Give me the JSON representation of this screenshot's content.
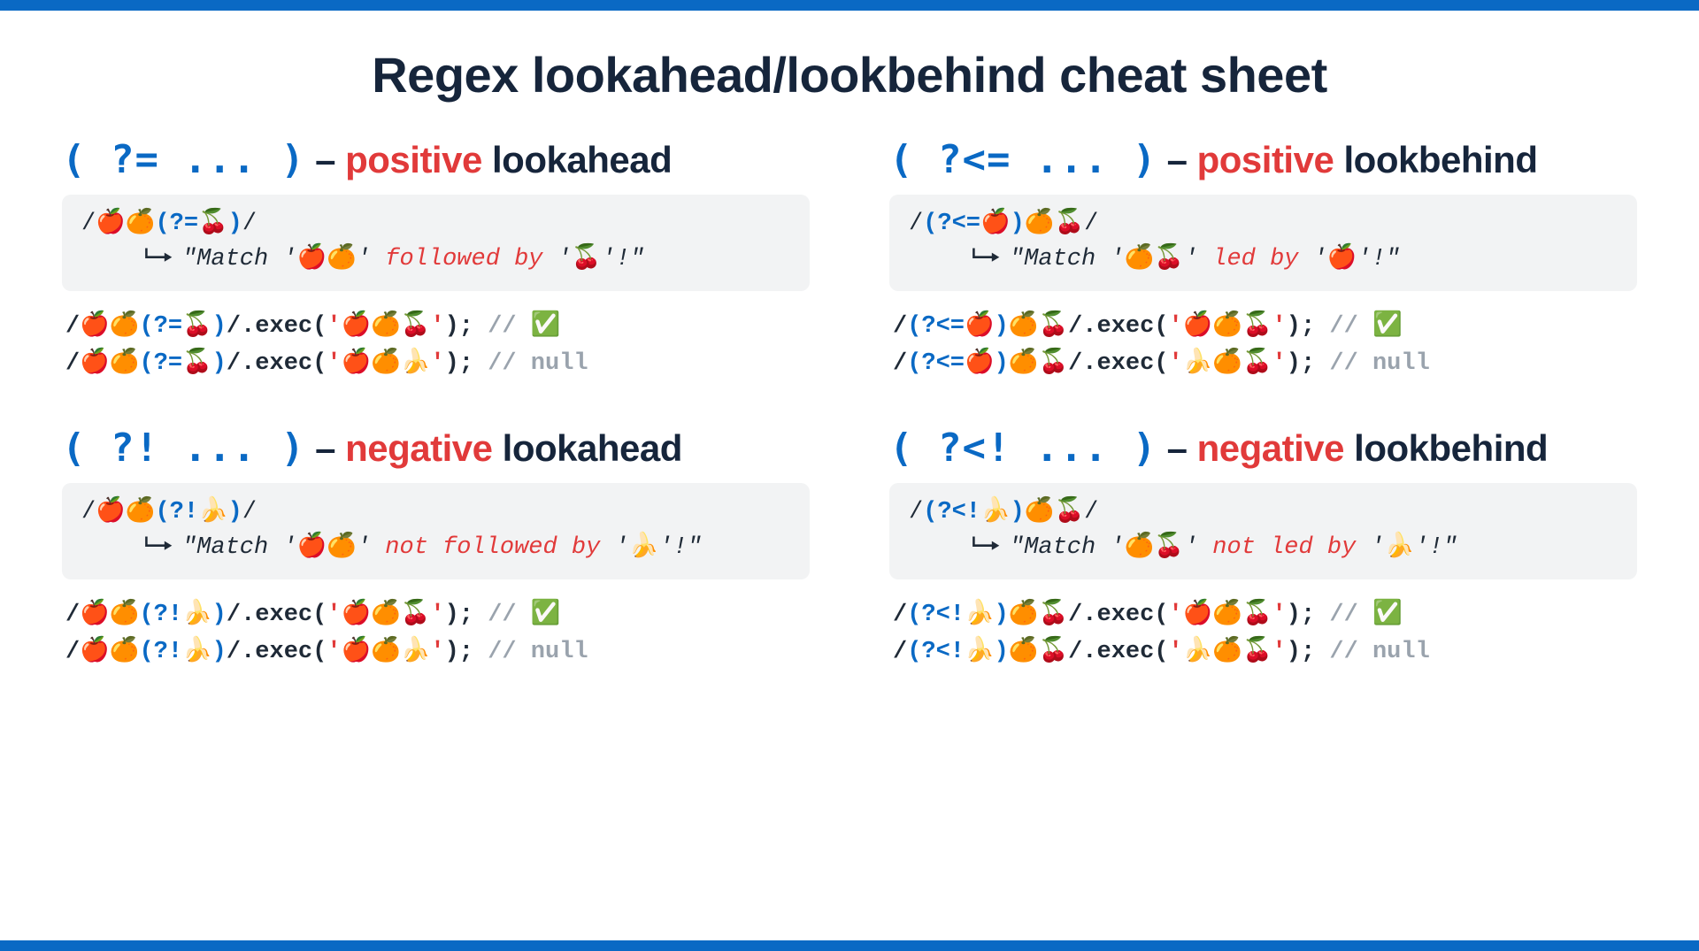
{
  "title": "Regex lookahead/lookbehind cheat sheet",
  "sections": [
    {
      "syntax": "( ?= ... )",
      "dash": " – ",
      "kind": "positive",
      "what": " lookahead",
      "box": {
        "pre": "/🍎🍊",
        "grp": "(?=🍒)",
        "post": "/",
        "desc_a": "\"Match '",
        "desc_b": "🍎🍊",
        "desc_c": "' ",
        "desc_em": "followed by",
        "desc_d": " '",
        "desc_e": "🍒",
        "desc_f": "'!\""
      },
      "ex": [
        {
          "pre": "/🍎🍊",
          "grp": "(?=🍒)",
          "mid": "/.exec(",
          "str": "'🍎🍊🍒'",
          "post": "); ",
          "cmt": "// ✅"
        },
        {
          "pre": "/🍎🍊",
          "grp": "(?=🍒)",
          "mid": "/.exec(",
          "str": "'🍎🍊🍌'",
          "post": "); ",
          "cmt": "// null"
        }
      ]
    },
    {
      "syntax": "( ?<= ... )",
      "dash": " – ",
      "kind": "positive",
      "what": " lookbehind",
      "box": {
        "pre": "/",
        "grp": "(?<=🍎)",
        "post": "🍊🍒/",
        "desc_a": "\"Match '",
        "desc_b": "🍊🍒",
        "desc_c": "' ",
        "desc_em": "led by",
        "desc_d": " '",
        "desc_e": "🍎",
        "desc_f": "'!\""
      },
      "ex": [
        {
          "pre": "/",
          "grp": "(?<=🍎)",
          "mid": "🍊🍒/.exec(",
          "str": "'🍎🍊🍒'",
          "post": "); ",
          "cmt": "// ✅"
        },
        {
          "pre": "/",
          "grp": "(?<=🍎)",
          "mid": "🍊🍒/.exec(",
          "str": "'🍌🍊🍒'",
          "post": "); ",
          "cmt": "// null"
        }
      ]
    },
    {
      "syntax": "( ?! ... )",
      "dash": " – ",
      "kind": "negative",
      "what": " lookahead",
      "box": {
        "pre": "/🍎🍊",
        "grp": "(?!🍌)",
        "post": "/",
        "desc_a": "\"Match '",
        "desc_b": "🍎🍊",
        "desc_c": "' ",
        "desc_em": "not followed by",
        "desc_d": " '",
        "desc_e": "🍌",
        "desc_f": "'!\""
      },
      "ex": [
        {
          "pre": "/🍎🍊",
          "grp": "(?!🍌)",
          "mid": "/.exec(",
          "str": "'🍎🍊🍒'",
          "post": "); ",
          "cmt": "// ✅"
        },
        {
          "pre": "/🍎🍊",
          "grp": "(?!🍌)",
          "mid": "/.exec(",
          "str": "'🍎🍊🍌'",
          "post": "); ",
          "cmt": "// null"
        }
      ]
    },
    {
      "syntax": "( ?<! ... )",
      "dash": " – ",
      "kind": "negative",
      "what": " lookbehind",
      "box": {
        "pre": "/",
        "grp": "(?<!🍌)",
        "post": "🍊🍒/",
        "desc_a": "\"Match '",
        "desc_b": "🍊🍒",
        "desc_c": "' ",
        "desc_em": "not led by",
        "desc_d": " '",
        "desc_e": "🍌",
        "desc_f": "'!\""
      },
      "ex": [
        {
          "pre": "/",
          "grp": "(?<!🍌)",
          "mid": "🍊🍒/.exec(",
          "str": "'🍎🍊🍒'",
          "post": "); ",
          "cmt": "// ✅"
        },
        {
          "pre": "/",
          "grp": "(?<!🍌)",
          "mid": "🍊🍒/.exec(",
          "str": "'🍌🍊🍒'",
          "post": "); ",
          "cmt": "// null"
        }
      ]
    }
  ]
}
